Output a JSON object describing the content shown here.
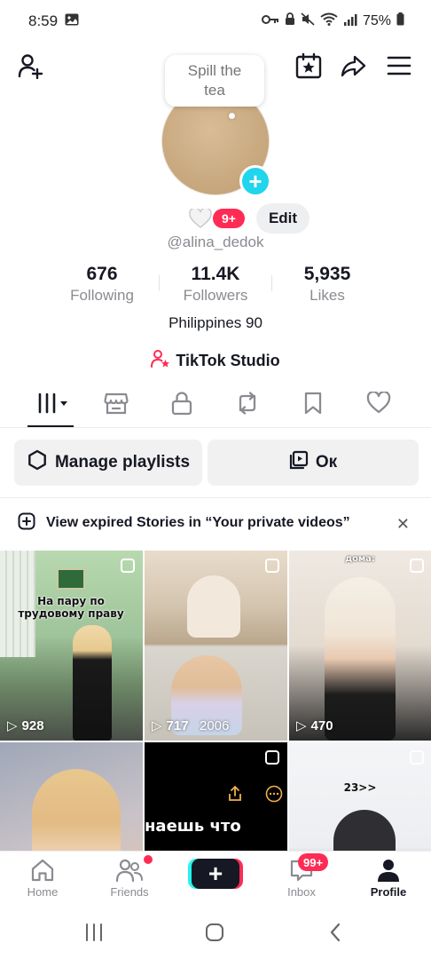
{
  "status_bar": {
    "time": "8:59",
    "battery": "75%"
  },
  "bubble": {
    "line1": "Spill the",
    "line2": "tea"
  },
  "profile": {
    "badge_count": "9+",
    "edit_label": "Edit",
    "username": "@alina_dedok",
    "bio": "Philippines 90",
    "studio_label": "TikTok Studio"
  },
  "stats": [
    {
      "value": "676",
      "label": "Following"
    },
    {
      "value": "11.4K",
      "label": "Followers"
    },
    {
      "value": "5,935",
      "label": "Likes"
    }
  ],
  "actions": {
    "playlists": "Manage playlists",
    "ok": "Ок"
  },
  "notice": {
    "text": "View expired Stories in “Your private videos”"
  },
  "grid": {
    "v1": {
      "views": "928",
      "caption1": "На пару по",
      "caption2": "трудовому праву"
    },
    "v2": {
      "views": "717",
      "caption": "2006"
    },
    "v3": {
      "views": "470",
      "caption": "дома:"
    },
    "v5": {
      "caption": "наешь что"
    },
    "v6": {
      "caption": "23>>"
    }
  },
  "bottom_nav": {
    "home": "Home",
    "friends": "Friends",
    "inbox": "Inbox",
    "inbox_badge": "99+",
    "profile": "Profile"
  },
  "colors": {
    "accent_red": "#fe2c55",
    "accent_cyan": "#20d5ec",
    "text_primary": "#161823",
    "text_secondary": "#8a8b91"
  }
}
